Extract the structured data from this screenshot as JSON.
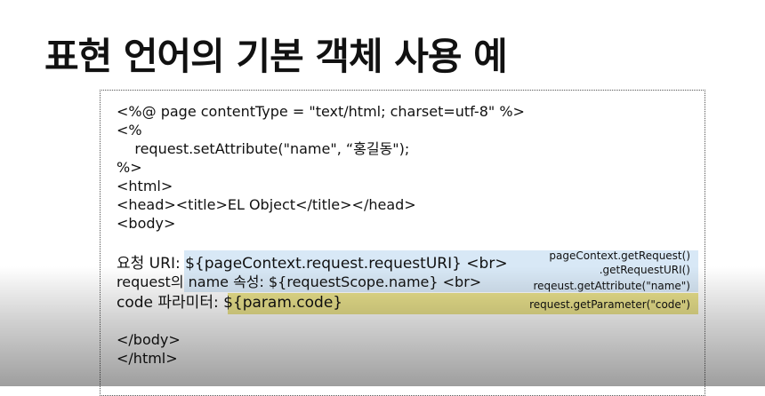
{
  "slide": {
    "title": "표현 언어의 기본 객체 사용 예"
  },
  "code": {
    "lines": [
      "<%@ page contentType = \"text/html; charset=utf-8\" %>",
      "<%",
      "    request.setAttribute(\"name\", “홍길동\");",
      "%>",
      "<html>",
      "<head><title>EL Object</title></head>",
      "<body>",
      "",
      "요청 URI: ${pageContext.request.requestURI} <br>",
      "request의 name 속성: ${requestScope.name} <br>",
      "code 파라미터: ${param.code}",
      "",
      "</body>",
      "</html>"
    ]
  },
  "notes": {
    "uri_line1": "pageContext.getRequest()",
    "uri_line2": ".getRequestURI()",
    "name": "reqeust.getAttribute(\"name\")",
    "code": "request.getParameter(\"code\")"
  },
  "colors": {
    "highlight_blue": "#d8e8f6",
    "highlight_yellow": "#eae28c"
  }
}
